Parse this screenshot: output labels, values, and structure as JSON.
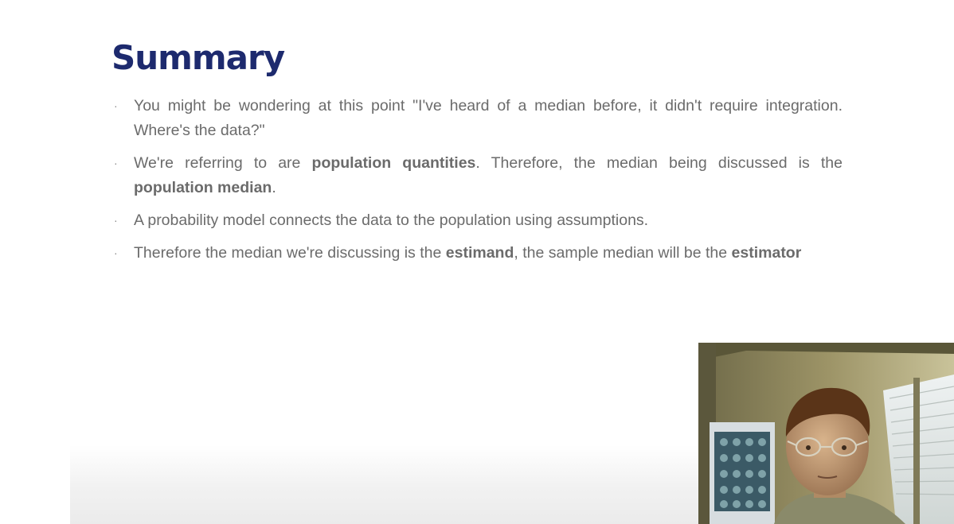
{
  "slide": {
    "title": "Summary",
    "bullets": [
      {
        "parts": [
          {
            "text": "You might be wondering at this point \"I've heard of a median before, it didn't require integration. Where's the data?\"",
            "bold": false
          }
        ]
      },
      {
        "parts": [
          {
            "text": "We're referring to are ",
            "bold": false
          },
          {
            "text": "population quantities",
            "bold": true
          },
          {
            "text": ". Therefore, the median being discussed is the ",
            "bold": false
          },
          {
            "text": "population median",
            "bold": true
          },
          {
            "text": ".",
            "bold": false
          }
        ]
      },
      {
        "parts": [
          {
            "text": "A probability model connects the data to the population using assumptions.",
            "bold": false
          }
        ]
      },
      {
        "parts": [
          {
            "text": "Therefore the median we're discussing is the ",
            "bold": false
          },
          {
            "text": "estimand",
            "bold": true
          },
          {
            "text": ", the sample median will be the ",
            "bold": false
          },
          {
            "text": "estimator",
            "bold": true
          }
        ]
      }
    ],
    "bullet_symbol": "·"
  },
  "colors": {
    "title": "#1d2a6e",
    "body_text": "#6b6b6b"
  },
  "webcam": {
    "subject": "presenter-video-feed"
  }
}
